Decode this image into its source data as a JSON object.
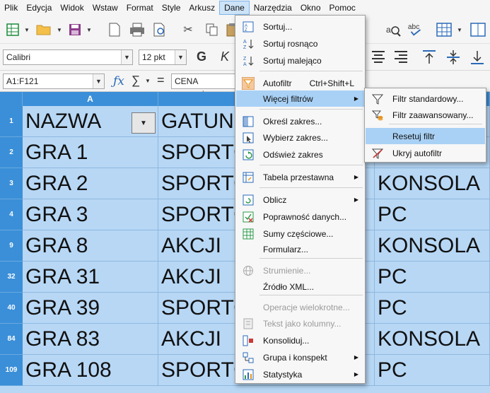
{
  "menubar": [
    "Plik",
    "Edycja",
    "Widok",
    "Wstaw",
    "Format",
    "Style",
    "Arkusz",
    "Dane",
    "Narzędzia",
    "Okno",
    "Pomoc"
  ],
  "active_menu": "Dane",
  "format": {
    "font": "Calibri",
    "size": "12 pkt",
    "bold": "G",
    "italic": "K"
  },
  "formula": {
    "cell_ref": "A1:F121",
    "content": "CENA WYPOŻYC"
  },
  "columns": [
    {
      "label": "A"
    }
  ],
  "rows": [
    {
      "num": "1",
      "a": "NAZWA",
      "b": "GATUN",
      "c": ""
    },
    {
      "num": "2",
      "a": "GRA 1",
      "b": "SPORTO",
      "c": ""
    },
    {
      "num": "3",
      "a": "GRA 2",
      "b": "SPORTO",
      "c": "KONSOLA"
    },
    {
      "num": "4",
      "a": "GRA 3",
      "b": "SPORTO",
      "c": "PC"
    },
    {
      "num": "9",
      "a": "GRA 8",
      "b": "AKCJI",
      "c": "KONSOLA"
    },
    {
      "num": "32",
      "a": "GRA 31",
      "b": "AKCJI",
      "c": "PC"
    },
    {
      "num": "40",
      "a": "GRA 39",
      "b": "SPORTO",
      "c": "PC"
    },
    {
      "num": "84",
      "a": "GRA 83",
      "b": "AKCJI",
      "c": "KONSOLA"
    },
    {
      "num": "109",
      "a": "GRA 108",
      "b": "SPORTO",
      "c": "PC"
    }
  ],
  "dane_menu": [
    {
      "label": "Sortuj...",
      "shortcut": "",
      "icon": "sort-icon",
      "sub": false,
      "disabled": false
    },
    {
      "label": "Sortuj rosnąco",
      "shortcut": "",
      "icon": "sort-ascending-icon",
      "sub": false,
      "disabled": false
    },
    {
      "label": "Sortuj malejąco",
      "shortcut": "",
      "icon": "sort-descending-icon",
      "sub": false,
      "disabled": false
    },
    {
      "label": "Autofiltr",
      "shortcut": "Ctrl+Shift+L",
      "icon": "autofilter-icon",
      "sub": false,
      "disabled": false
    },
    {
      "label": "Więcej filtrów",
      "shortcut": "",
      "icon": "",
      "sub": true,
      "disabled": false
    },
    {
      "label": "Określ zakres...",
      "shortcut": "",
      "icon": "define-range-icon",
      "sub": false,
      "disabled": false
    },
    {
      "label": "Wybierz zakres...",
      "shortcut": "",
      "icon": "select-range-icon",
      "sub": false,
      "disabled": false
    },
    {
      "label": "Odśwież zakres",
      "shortcut": "",
      "icon": "refresh-range-icon",
      "sub": false,
      "disabled": false
    },
    {
      "label": "Tabela przestawna",
      "shortcut": "",
      "icon": "pivot-table-icon",
      "sub": true,
      "disabled": false
    },
    {
      "label": "Oblicz",
      "shortcut": "",
      "icon": "calculate-icon",
      "sub": true,
      "disabled": false
    },
    {
      "label": "Poprawność danych...",
      "shortcut": "",
      "icon": "validation-icon",
      "sub": false,
      "disabled": false
    },
    {
      "label": "Sumy częściowe...",
      "shortcut": "",
      "icon": "subtotals-icon",
      "sub": false,
      "disabled": false
    },
    {
      "label": "Formularz...",
      "shortcut": "",
      "icon": "",
      "sub": false,
      "disabled": false
    },
    {
      "label": "Strumienie...",
      "shortcut": "",
      "icon": "globe-icon",
      "sub": false,
      "disabled": true
    },
    {
      "label": "Źródło XML...",
      "shortcut": "",
      "icon": "",
      "sub": false,
      "disabled": false
    },
    {
      "label": "Operacje wielokrotne...",
      "shortcut": "",
      "icon": "",
      "sub": false,
      "disabled": true
    },
    {
      "label": "Tekst jako kolumny...",
      "shortcut": "",
      "icon": "text-to-columns-icon",
      "sub": false,
      "disabled": true
    },
    {
      "label": "Konsoliduj...",
      "shortcut": "",
      "icon": "consolidate-icon",
      "sub": false,
      "disabled": false
    },
    {
      "label": "Grupa i konspekt",
      "shortcut": "",
      "icon": "group-outline-icon",
      "sub": true,
      "disabled": false
    },
    {
      "label": "Statystyka",
      "shortcut": "",
      "icon": "statistics-icon",
      "sub": true,
      "disabled": false
    }
  ],
  "filters_submenu": [
    {
      "label": "Filtr standardowy...",
      "icon": "standard-filter-icon"
    },
    {
      "label": "Filtr zaawansowany...",
      "icon": "advanced-filter-icon"
    },
    {
      "label": "Resetuj filtr",
      "icon": ""
    },
    {
      "label": "Ukryj autofiltr",
      "icon": "hide-autofilter-icon"
    }
  ]
}
